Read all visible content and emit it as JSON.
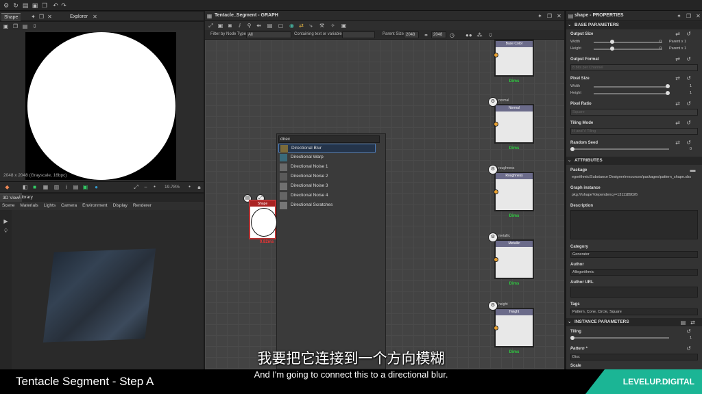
{
  "viewer2d": {
    "tabs": [
      "Shape",
      "Explorer"
    ],
    "info": "2048 x 2048 (Grayscale, 16bpc)",
    "zoom": "19.78%"
  },
  "viewer3d": {
    "tabs": [
      "3D View",
      "Library"
    ],
    "menu": [
      "Scene",
      "Materials",
      "Lights",
      "Camera",
      "Environment",
      "Display",
      "Renderer"
    ]
  },
  "graph": {
    "title": "Tentacle_Segment - GRAPH",
    "filter": {
      "filter_label": "Filter by Node Type",
      "filter_value": "All",
      "containing_label": "Containing text or variable",
      "parent_size_label": "Parent Size:",
      "parent_size_value": "2048",
      "size_value": "2048"
    },
    "nodes": [
      {
        "tag": "",
        "title": "Base Color",
        "output": "Dims"
      },
      {
        "tag": "normal",
        "title": "Normal",
        "output": "Dims"
      },
      {
        "tag": "roughness",
        "title": "Roughness",
        "output": "Dims"
      },
      {
        "tag": "metallic",
        "title": "Metallic",
        "output": "Dims"
      },
      {
        "tag": "height",
        "title": "Height",
        "output": "Dims"
      }
    ],
    "shape_node": {
      "title": "Shape",
      "label": "0.82ms"
    }
  },
  "search_popup": {
    "query": "direc",
    "items": [
      {
        "label": "Directional Blur",
        "color": "#7a6a3a"
      },
      {
        "label": "Directional Warp",
        "color": "#3a6a7a"
      },
      {
        "label": "Directional Noise 1",
        "color": "#6a6a6a"
      },
      {
        "label": "Directional Noise 2",
        "color": "#5a5a5a"
      },
      {
        "label": "Directional Noise 3",
        "color": "#707070"
      },
      {
        "label": "Directional Noise 4",
        "color": "#656565"
      },
      {
        "label": "Directional Scratches",
        "color": "#777777"
      }
    ]
  },
  "properties": {
    "title": "shape - PROPERTIES",
    "base_parameters": "BASE PARAMETERS",
    "output_size": "Output Size",
    "width_label": "Width",
    "height_label": "Height",
    "width_value": "0",
    "height_value": "0",
    "parent_x1": "Parent x 1",
    "output_format": "Output Format",
    "output_format_value": "8 bits per Channel",
    "pixel_size": "Pixel Size",
    "pixel_width_value": "1",
    "pixel_height_value": "1",
    "pixel_ratio": "Pixel Ratio",
    "pixel_ratio_value": "Square",
    "tiling_mode": "Tiling Mode",
    "tiling_mode_value": "H and V Tiling",
    "random_seed": "Random Seed",
    "random_seed_value": "0",
    "attributes": "ATTRIBUTES",
    "package": "Package",
    "package_value": "egorithmic/Substance Designer/resources/packages/pattern_shape.sbs",
    "graph_instance": "Graph instance",
    "graph_instance_value": "pkg:///shape?dependency=1311189026",
    "description": "Description",
    "category": "Category",
    "category_value": "Generator",
    "author": "Author",
    "author_value": "Allegorithmic",
    "author_url": "Author URL",
    "tags": "Tags",
    "tags_value": "Pattern, Cone, Circle, Square",
    "instance_parameters": "INSTANCE PARAMETERS",
    "tiling": "Tiling",
    "tiling_value": "1",
    "pattern": "Pattern *",
    "pattern_value": "Disc",
    "scale": "Scale"
  },
  "footer": {
    "title": "Tentacle Segment - Step A",
    "brand": "LEVELUP.DIGITAL"
  },
  "subtitles": {
    "chinese": "我要把它连接到一个方向模糊",
    "english": "And I'm going to connect this to a directional blur."
  }
}
